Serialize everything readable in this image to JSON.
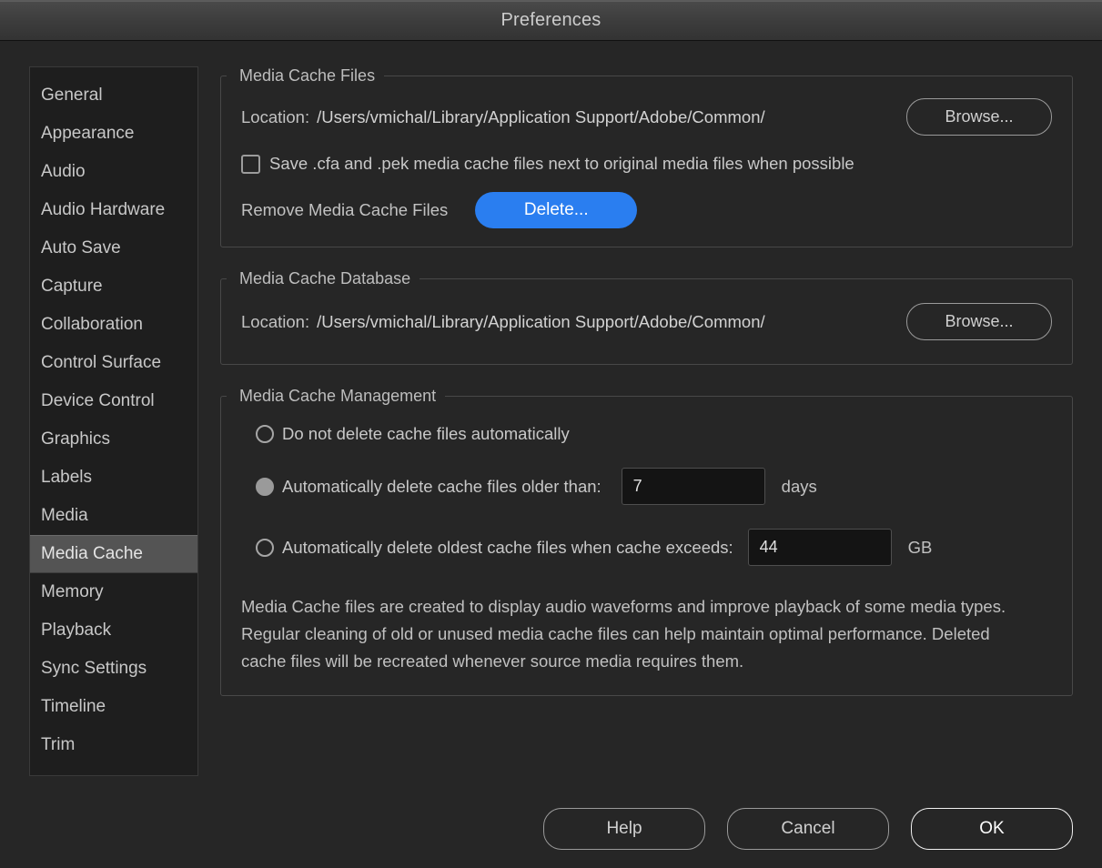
{
  "window": {
    "title": "Preferences"
  },
  "sidebar": {
    "items": [
      {
        "label": "General",
        "selected": false
      },
      {
        "label": "Appearance",
        "selected": false
      },
      {
        "label": "Audio",
        "selected": false
      },
      {
        "label": "Audio Hardware",
        "selected": false
      },
      {
        "label": "Auto Save",
        "selected": false
      },
      {
        "label": "Capture",
        "selected": false
      },
      {
        "label": "Collaboration",
        "selected": false
      },
      {
        "label": "Control Surface",
        "selected": false
      },
      {
        "label": "Device Control",
        "selected": false
      },
      {
        "label": "Graphics",
        "selected": false
      },
      {
        "label": "Labels",
        "selected": false
      },
      {
        "label": "Media",
        "selected": false
      },
      {
        "label": "Media Cache",
        "selected": true
      },
      {
        "label": "Memory",
        "selected": false
      },
      {
        "label": "Playback",
        "selected": false
      },
      {
        "label": "Sync Settings",
        "selected": false
      },
      {
        "label": "Timeline",
        "selected": false
      },
      {
        "label": "Trim",
        "selected": false
      }
    ]
  },
  "media_cache_files": {
    "legend": "Media Cache Files",
    "location_label": "Location:",
    "location_path": "/Users/vmichal/Library/Application Support/Adobe/Common/",
    "browse_label": "Browse...",
    "save_checkbox_label": "Save .cfa and .pek media cache files next to original media files when possible",
    "save_checkbox_checked": false,
    "remove_label": "Remove Media Cache Files",
    "delete_label": "Delete..."
  },
  "media_cache_database": {
    "legend": "Media Cache Database",
    "location_label": "Location:",
    "location_path": "/Users/vmichal/Library/Application Support/Adobe/Common/",
    "browse_label": "Browse..."
  },
  "media_cache_management": {
    "legend": "Media Cache Management",
    "options": [
      {
        "label": "Do not delete cache files automatically",
        "selected": false
      },
      {
        "label": "Automatically delete cache files older than:",
        "selected": true
      },
      {
        "label": "Automatically delete oldest cache files when cache exceeds:",
        "selected": false
      }
    ],
    "days_value": "7",
    "days_unit": "days",
    "size_value": "44",
    "size_unit": "GB",
    "description": "Media Cache files are created to display audio waveforms and improve playback of some media types.  Regular cleaning of old or unused media cache files can help maintain optimal performance. Deleted cache files will be recreated whenever source media requires them."
  },
  "footer": {
    "help_label": "Help",
    "cancel_label": "Cancel",
    "ok_label": "OK"
  },
  "colors": {
    "accent_blue": "#2a7ef0",
    "dialog_bg": "#262626",
    "sidebar_bg": "#1e1e1e",
    "selection_bg": "#545454"
  }
}
